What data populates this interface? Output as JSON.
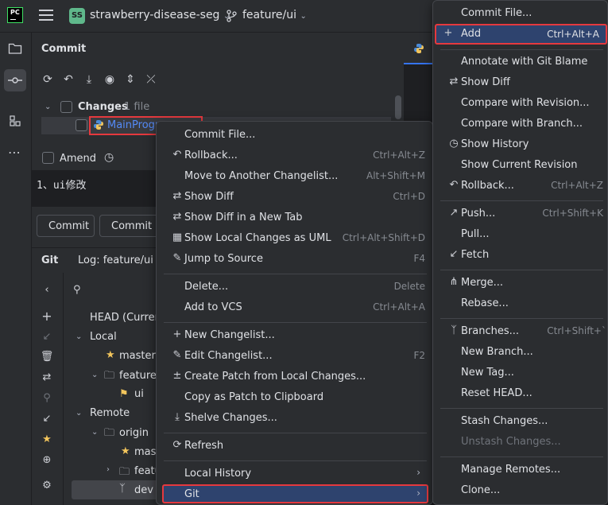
{
  "topbar": {
    "logo": "PC",
    "project_initials": "SS",
    "project_name": "strawberry-disease-seg",
    "branch": "feature/ui"
  },
  "commit_panel": {
    "title": "Commit",
    "changes_label": "Changes",
    "changes_count": "1 file",
    "file_name": "MainProgr",
    "amend_label": "Amend",
    "message": "1、ui修改",
    "commit_button": "Commit",
    "commit_push_button": "Commit a"
  },
  "git_panel": {
    "tab_git": "Git",
    "tab_log": "Log: feature/ui",
    "tree": {
      "head": "HEAD (Current",
      "local": "Local",
      "master": "master",
      "feature": "feature",
      "ui": "ui",
      "remote": "Remote",
      "origin": "origin",
      "origin_master": "mast",
      "origin_feature": "featu",
      "dev": "dev"
    }
  },
  "context_menu": {
    "items": [
      {
        "label": "Commit File...",
        "shortcut": ""
      },
      {
        "label": "Rollback...",
        "shortcut": "Ctrl+Alt+Z"
      },
      {
        "label": "Move to Another Changelist...",
        "shortcut": "Alt+Shift+M"
      },
      {
        "label": "Show Diff",
        "shortcut": "Ctrl+D"
      },
      {
        "label": "Show Diff in a New Tab",
        "shortcut": ""
      },
      {
        "label": "Show Local Changes as UML",
        "shortcut": "Ctrl+Alt+Shift+D"
      },
      {
        "label": "Jump to Source",
        "shortcut": "F4"
      },
      {
        "label": "Delete...",
        "shortcut": "Delete"
      },
      {
        "label": "Add to VCS",
        "shortcut": "Ctrl+Alt+A"
      },
      {
        "label": "New Changelist...",
        "shortcut": ""
      },
      {
        "label": "Edit Changelist...",
        "shortcut": "F2"
      },
      {
        "label": "Create Patch from Local Changes...",
        "shortcut": ""
      },
      {
        "label": "Copy as Patch to Clipboard",
        "shortcut": ""
      },
      {
        "label": "Shelve Changes...",
        "shortcut": ""
      },
      {
        "label": "Refresh",
        "shortcut": ""
      },
      {
        "label": "Local History",
        "shortcut": ""
      },
      {
        "label": "Git",
        "shortcut": ""
      }
    ]
  },
  "git_submenu": {
    "items": [
      {
        "label": "Commit File...",
        "shortcut": ""
      },
      {
        "label": "Add",
        "shortcut": "Ctrl+Alt+A"
      },
      {
        "label": "Annotate with Git Blame",
        "shortcut": ""
      },
      {
        "label": "Show Diff",
        "shortcut": ""
      },
      {
        "label": "Compare with Revision...",
        "shortcut": ""
      },
      {
        "label": "Compare with Branch...",
        "shortcut": ""
      },
      {
        "label": "Show History",
        "shortcut": ""
      },
      {
        "label": "Show Current Revision",
        "shortcut": ""
      },
      {
        "label": "Rollback...",
        "shortcut": "Ctrl+Alt+Z"
      },
      {
        "label": "Push...",
        "shortcut": "Ctrl+Shift+K"
      },
      {
        "label": "Pull...",
        "shortcut": ""
      },
      {
        "label": "Fetch",
        "shortcut": ""
      },
      {
        "label": "Merge...",
        "shortcut": ""
      },
      {
        "label": "Rebase...",
        "shortcut": ""
      },
      {
        "label": "Branches...",
        "shortcut": "Ctrl+Shift+`"
      },
      {
        "label": "New Branch...",
        "shortcut": ""
      },
      {
        "label": "New Tag...",
        "shortcut": ""
      },
      {
        "label": "Reset HEAD...",
        "shortcut": ""
      },
      {
        "label": "Stash Changes...",
        "shortcut": ""
      },
      {
        "label": "Unstash Changes...",
        "shortcut": ""
      },
      {
        "label": "Manage Remotes...",
        "shortcut": ""
      },
      {
        "label": "Clone...",
        "shortcut": ""
      }
    ]
  },
  "colors": {
    "highlight": "#2e436e",
    "red_outline": "#e5393e",
    "link_blue": "#548af7",
    "star": "#f2c55c"
  }
}
